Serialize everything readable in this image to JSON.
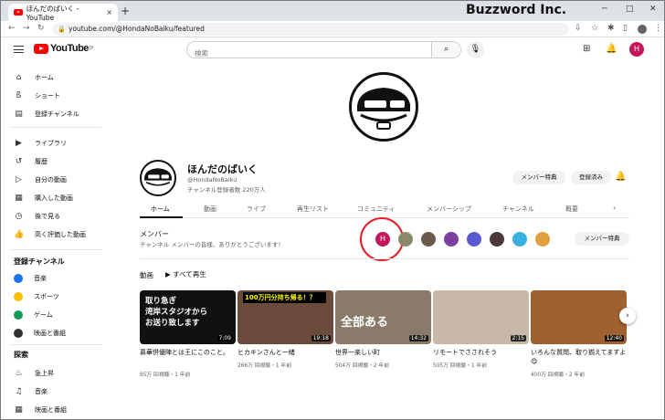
{
  "browser": {
    "tab_title": "ほんだのばいく - YouTube",
    "tab_close": "×",
    "new_tab": "+",
    "url": "youtube.com/@HondaNoBaiku/featured",
    "brand": "Buzzword Inc."
  },
  "header": {
    "logo_text": "YouTube",
    "logo_sup": "JP",
    "search_placeholder": "検索",
    "avatar_letter": "H"
  },
  "sidebar": {
    "main": [
      {
        "label": "ホーム",
        "icon": "home-icon"
      },
      {
        "label": "ショート",
        "icon": "shorts-icon"
      },
      {
        "label": "登録チャンネル",
        "icon": "subscriptions-icon"
      }
    ],
    "library": [
      {
        "label": "ライブラリ",
        "icon": "library-icon"
      },
      {
        "label": "履歴",
        "icon": "history-icon"
      },
      {
        "label": "自分の動画",
        "icon": "your-videos-icon"
      },
      {
        "label": "購入した動画",
        "icon": "purchases-icon"
      },
      {
        "label": "後で見る",
        "icon": "watch-later-icon"
      },
      {
        "label": "高く評価した動画",
        "icon": "liked-icon"
      }
    ],
    "subs_header": "登録チャンネル",
    "subs": [
      {
        "label": "音楽",
        "color": "#1a73e8"
      },
      {
        "label": "スポーツ",
        "color": "#fbbc04"
      },
      {
        "label": "ゲーム",
        "color": "#0f9d58"
      },
      {
        "label": "映画と番組",
        "color": "#303030"
      }
    ],
    "explore_header": "探索",
    "explore": [
      {
        "label": "急上昇",
        "icon": "trending-icon"
      },
      {
        "label": "音楽",
        "icon": "music-icon"
      },
      {
        "label": "映画と番組",
        "icon": "movies-icon"
      }
    ]
  },
  "channel": {
    "name": "ほんだのばいく",
    "handle": "@HondaNoBaiku",
    "subscribers": "チャンネル登録者数 220万人",
    "member_button": "メンバー特典",
    "subscribed_button": "登録済み",
    "tabs": [
      "ホーム",
      "動画",
      "ライブ",
      "再生リスト",
      "コミュニティ",
      "メンバーシップ",
      "チャンネル",
      "概要"
    ],
    "tabs_more": "›"
  },
  "members": {
    "title": "メンバー",
    "subtitle": "チャンネル メンバーの皆様、ありがとうございます！",
    "avatar_letter": "H",
    "perks_button": "メンバー特典",
    "avatar_colors": [
      "#8a8a6a",
      "#6a5a4a",
      "#7b3fa0",
      "#5a5ad0",
      "#4a3a3a",
      "#3ab0e0",
      "#e0a040"
    ]
  },
  "videos": {
    "title": "動画",
    "play_all": "すべて再生",
    "items": [
      {
        "thumb_text": "取り急ぎ\n湾岸スタジオから\nお送り致します",
        "thumb_bg": "#111111",
        "duration": "7:09",
        "title": "慕華併優陣とは王にこのこと。",
        "meta": "95万 回視聴・1 年前"
      },
      {
        "thumb_text": "100万円分持ち帰る！？",
        "thumb_bg": "#6a4a3a",
        "duration": "19:18",
        "title": "ヒカキンさんと一緒",
        "meta": "266万 回視聴・1 年前"
      },
      {
        "thumb_text": "全部ある",
        "thumb_bg": "#8a7a6a",
        "duration": "14:32",
        "title": "世界一楽しい町",
        "meta": "504万 回視聴・2 年前"
      },
      {
        "thumb_text": "",
        "thumb_bg": "#c8b8a8",
        "duration": "2:15",
        "title": "リモートでさされそう",
        "meta": "505万 回視聴・1 年前"
      },
      {
        "thumb_text": "",
        "thumb_bg": "#a06030",
        "duration": "12:40",
        "title": "いろんな質問、取り揃えてますよ😋",
        "meta": "400万 回視聴・2 年前"
      }
    ],
    "next": "›"
  }
}
